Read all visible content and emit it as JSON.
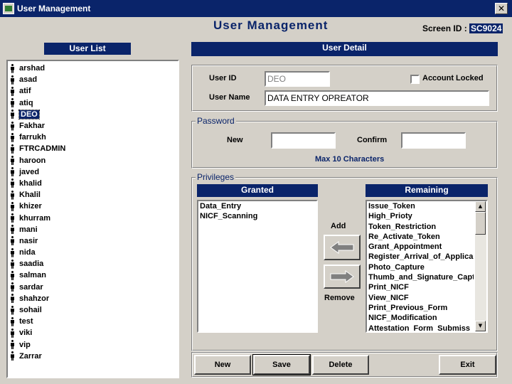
{
  "window": {
    "title": "User Management",
    "close_glyph": "✕"
  },
  "header": {
    "title": "User Management",
    "screen_id_label": "Screen ID :",
    "screen_id": "SC9024"
  },
  "user_list": {
    "title": "User List",
    "selected": "DEO",
    "users": [
      "arshad",
      "asad",
      "atif",
      "atiq",
      "DEO",
      "Fakhar",
      "farrukh",
      "FTRCADMIN",
      "haroon",
      "javed",
      "khalid",
      "Khalil",
      "khizer",
      "khurram",
      "mani",
      "nasir",
      "nida",
      "saadia",
      "salman",
      "sardar",
      "shahzor",
      "sohail",
      "test",
      "viki",
      "vip",
      "Zarrar"
    ]
  },
  "user_detail": {
    "title": "User Detail",
    "user_id_label": "User ID",
    "user_id_value": "DEO",
    "account_locked_label": "Account Locked",
    "user_name_label": "User Name",
    "user_name_value": "DATA ENTRY OPREATOR"
  },
  "password": {
    "legend": "Password",
    "new_label": "New",
    "confirm_label": "Confirm",
    "note": "Max 10 Characters"
  },
  "privileges": {
    "legend": "Privileges",
    "granted_title": "Granted",
    "remaining_title": "Remaining",
    "add_label": "Add",
    "remove_label": "Remove",
    "granted": [
      "Data_Entry",
      "NICF_Scanning"
    ],
    "remaining": [
      "Issue_Token",
      "High_Prioty",
      "Token_Restriction",
      "Re_Activate_Token",
      "Grant_Appointment",
      "Register_Arrival_of_Applica",
      "Photo_Capture",
      "Thumb_and_Signature_Capt",
      "Print_NICF",
      "View_NICF",
      "Print_Previous_Form",
      "NICF_Modification",
      "Attestation_Form_Submiss"
    ]
  },
  "buttons": {
    "new": "New",
    "save": "Save",
    "delete": "Delete",
    "exit": "Exit"
  },
  "colors": {
    "accent": "#0a246a",
    "face": "#d4d0c8"
  }
}
